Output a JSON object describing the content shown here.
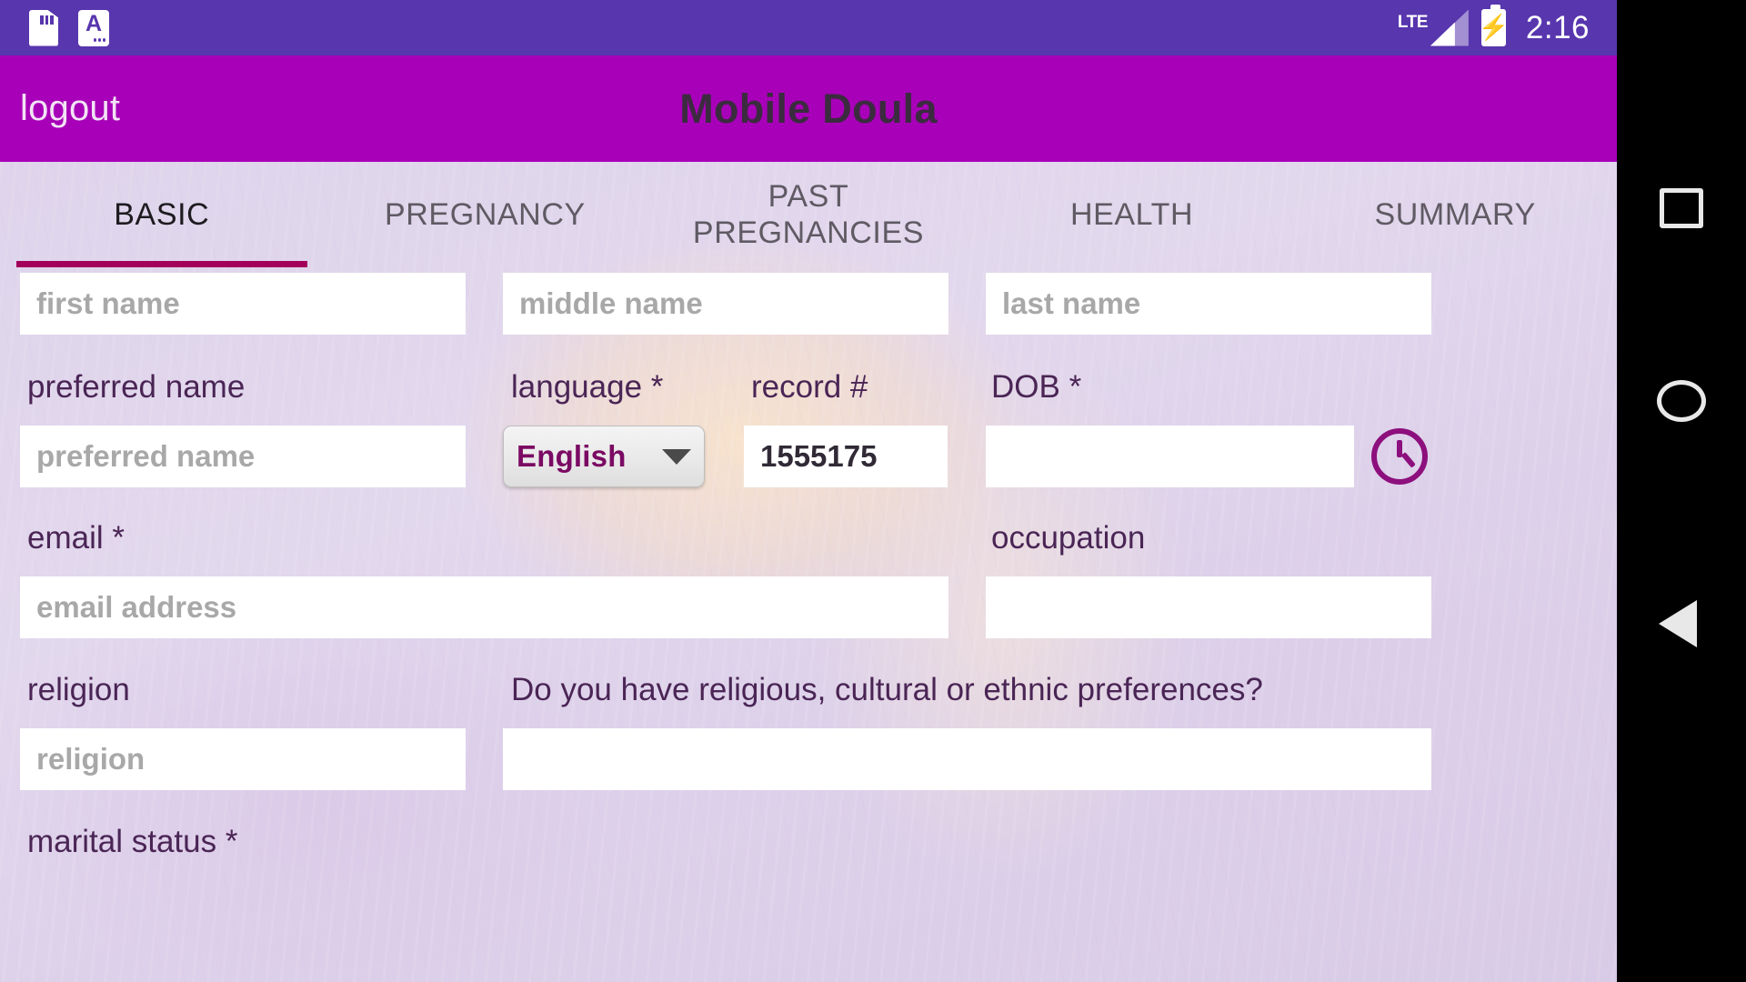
{
  "status_bar": {
    "icons": [
      "sd-card-icon",
      "screenshot-a-icon"
    ],
    "network_label": "LTE",
    "battery": "charging",
    "time": "2:16"
  },
  "app_bar": {
    "logout_label": "logout",
    "title": "Mobile Doula"
  },
  "tabs": [
    {
      "label": "BASIC",
      "active": true
    },
    {
      "label": "PREGNANCY",
      "active": false
    },
    {
      "label": "PAST PREGNANCIES",
      "active": false
    },
    {
      "label": "HEALTH",
      "active": false
    },
    {
      "label": "SUMMARY",
      "active": false
    }
  ],
  "form": {
    "first_name": {
      "placeholder": "first name",
      "value": ""
    },
    "middle_name": {
      "placeholder": "middle name",
      "value": ""
    },
    "last_name": {
      "placeholder": "last name",
      "value": ""
    },
    "preferred_name": {
      "label": "preferred name",
      "placeholder": "preferred name",
      "value": ""
    },
    "language": {
      "label": "language *",
      "value": "English"
    },
    "record_number": {
      "label": "record #",
      "value": "1555175"
    },
    "dob": {
      "label": "DOB *",
      "value": "",
      "picker_icon": "clock-icon"
    },
    "email": {
      "label": "email *",
      "placeholder": "email address",
      "value": ""
    },
    "occupation": {
      "label": "occupation",
      "value": ""
    },
    "religion": {
      "label": "religion",
      "placeholder": "religion",
      "value": ""
    },
    "preferences": {
      "label": "Do you have religious, cultural or ethnic preferences?",
      "value": ""
    },
    "marital_status": {
      "label": "marital status *"
    }
  },
  "nav_bar": {
    "recent_label": "recent-apps",
    "home_label": "home",
    "back_label": "back"
  },
  "colors": {
    "status_bar": "#5836ae",
    "app_bar": "#a800b8",
    "tab_indicator": "#a3005b",
    "label_text": "#4a2555",
    "select_text": "#7b0a63",
    "clock_icon": "#8d0f7d"
  }
}
